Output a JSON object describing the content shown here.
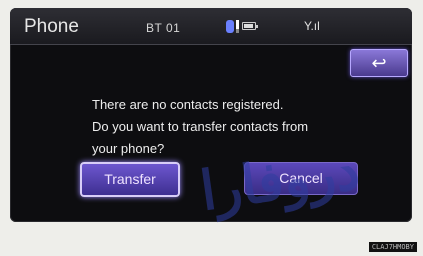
{
  "header": {
    "title": "Phone",
    "device_name": "BT 01",
    "signal_text": "Y.ıl"
  },
  "icons": {
    "back": "↩"
  },
  "dialog": {
    "lines": [
      "There are no contacts registered.",
      "Do you want to transfer contacts from",
      "your phone?"
    ]
  },
  "buttons": {
    "transfer": "Transfer",
    "cancel": "Cancel"
  },
  "watermark": "دروفارا",
  "image_code": "CLAJ7HMOBY"
}
